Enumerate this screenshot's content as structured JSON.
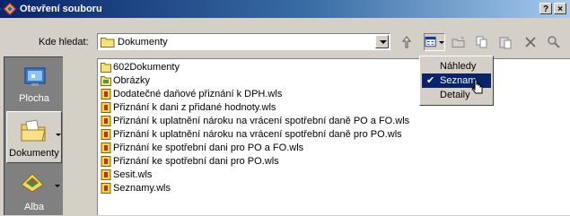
{
  "window": {
    "title": "Otevření souboru",
    "help_label": "?",
    "close_label": "×"
  },
  "lookin": {
    "label": "Kde hledat:",
    "value": "Dokumenty"
  },
  "places": [
    {
      "label": "Plocha"
    },
    {
      "label": "Dokumenty"
    },
    {
      "label": "Alba"
    }
  ],
  "files": [
    {
      "name": "602Dokumenty",
      "type": "folder"
    },
    {
      "name": "Obrázky",
      "type": "picture-folder"
    },
    {
      "name": "Dodatečné daňové přiznání k DPH.wls",
      "type": "wls"
    },
    {
      "name": "Přiznání k dani z přidané hodnoty.wls",
      "type": "wls"
    },
    {
      "name": "Přiznání k uplatnění nároku na vrácení spotřební daně  PO a FO.wls",
      "type": "wls"
    },
    {
      "name": "Přiznání k uplatnění nároku na vrácení spotřební daně pro PO.wls",
      "type": "wls"
    },
    {
      "name": "Přiznání ke spotřební dani pro PO a FO.wls",
      "type": "wls"
    },
    {
      "name": "Přiznání ke spotřební dani pro PO.wls",
      "type": "wls"
    },
    {
      "name": "Sesit.wls",
      "type": "wls"
    },
    {
      "name": "Seznamy.wls",
      "type": "wls"
    }
  ],
  "view_menu": {
    "items": [
      {
        "label": "Náhledy",
        "checked": false
      },
      {
        "label": "Seznam",
        "checked": true
      },
      {
        "label": "Detaily",
        "checked": false
      }
    ]
  },
  "colors": {
    "titlebar": "#0a246a",
    "highlight": "#0a246a",
    "face": "#d4d0c8"
  }
}
